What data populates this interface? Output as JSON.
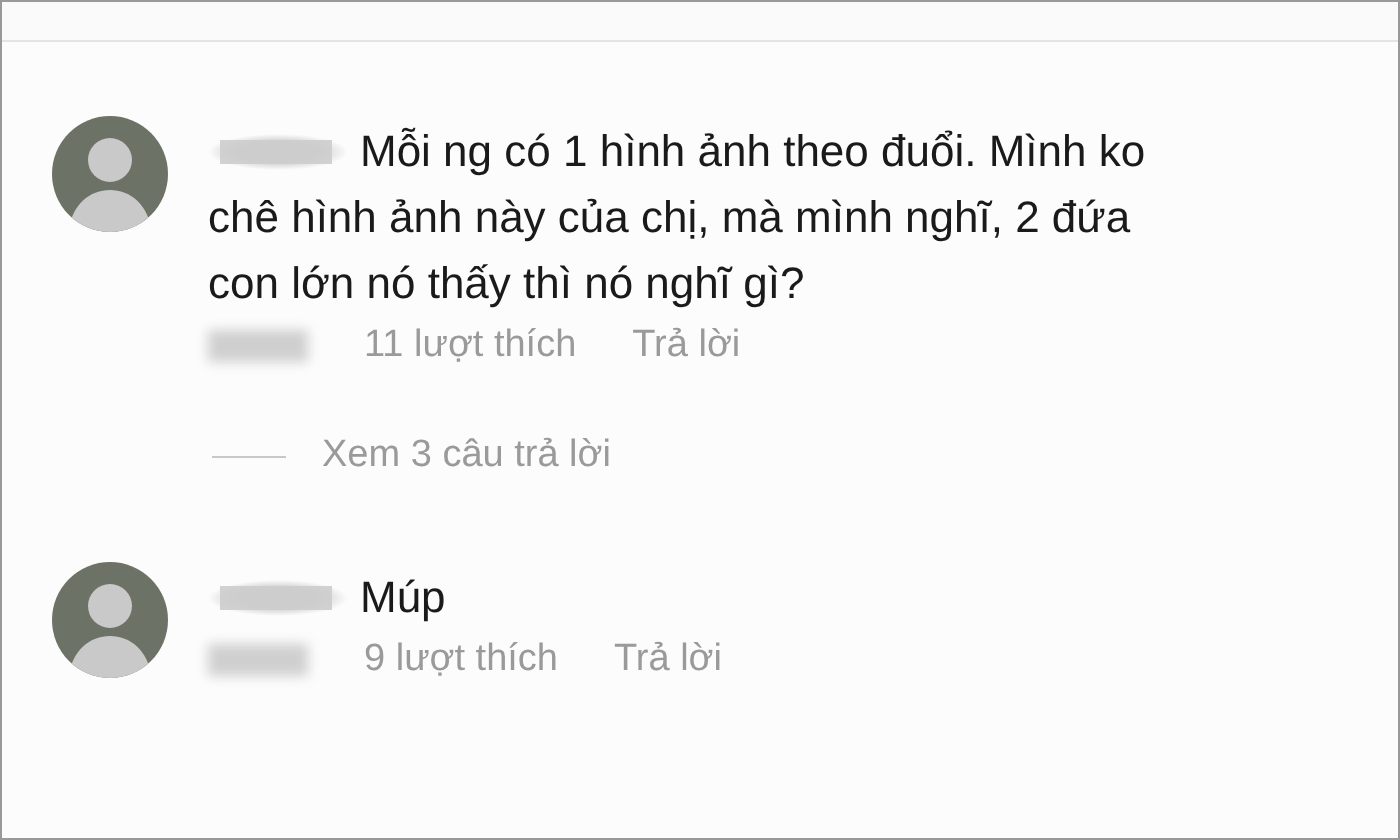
{
  "comments": [
    {
      "text": "Mỗi ng có 1 hình ảnh theo đuổi. Mình ko chê hình ảnh này của chị, mà mình nghĩ, 2 đứa con lớn nó thấy thì nó nghĩ gì?",
      "likes": "11 lượt thích",
      "reply": "Trả lời",
      "view_replies": "Xem 3 câu trả lời"
    },
    {
      "text": "Múp",
      "likes": "9 lượt thích",
      "reply": "Trả lời"
    }
  ]
}
